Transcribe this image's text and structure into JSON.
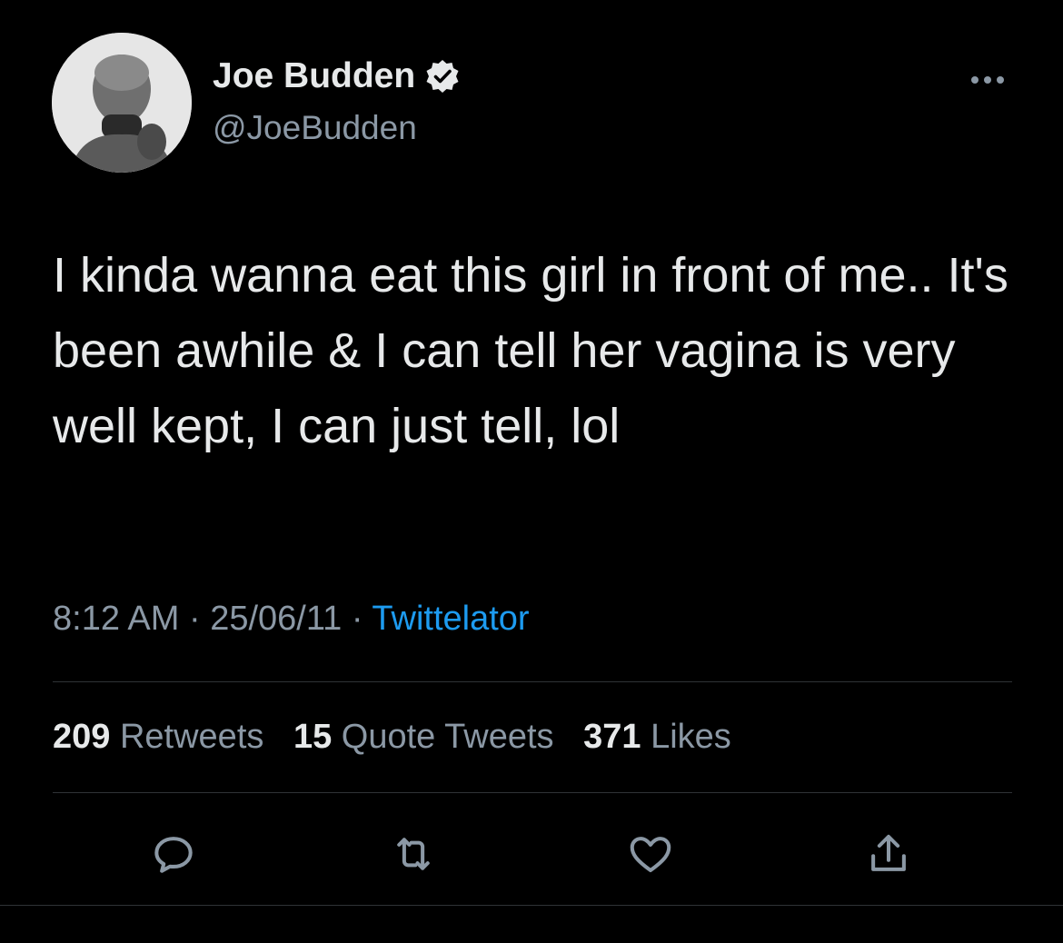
{
  "author": {
    "display_name": "Joe Budden",
    "handle": "@JoeBudden",
    "avatar_icon": "person-avatar",
    "verified_icon": "verified-badge-icon"
  },
  "tweet": {
    "text": "I kinda wanna eat this girl in front of me.. It's been awhile & I can tell her vagina is very well kept, I can just tell, lol",
    "time": "8:12 AM",
    "date": "25/06/11",
    "separator": "·",
    "source": "Twittelator"
  },
  "stats": {
    "retweets_count": "209",
    "retweets_label": "Retweets",
    "quotes_count": "15",
    "quotes_label": "Quote Tweets",
    "likes_count": "371",
    "likes_label": "Likes"
  },
  "actions": [
    "reply-icon",
    "retweet-icon",
    "like-icon",
    "share-icon"
  ],
  "colors": {
    "background": "#000000",
    "text": "#e7e9ea",
    "secondary": "#8b98a5",
    "link": "#1d9bf0"
  }
}
